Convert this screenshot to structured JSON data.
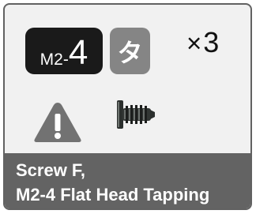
{
  "part": {
    "size_prefix": "M2-",
    "size_number": "4",
    "type_glyph": "タ",
    "quantity_symbol": "×",
    "quantity": "3",
    "name_line1": "Screw F,",
    "name_line2": "M2-4 Flat Head Tapping"
  },
  "icons": {
    "warning": "warning-triangle-icon",
    "screw": "screw-icon"
  },
  "colors": {
    "card_background": "#f1f1f1",
    "card_border": "#626262",
    "size_badge": "#1a1a1a",
    "type_badge": "#858585",
    "caption_band": "#636363",
    "warning_triangle": "#727272"
  }
}
